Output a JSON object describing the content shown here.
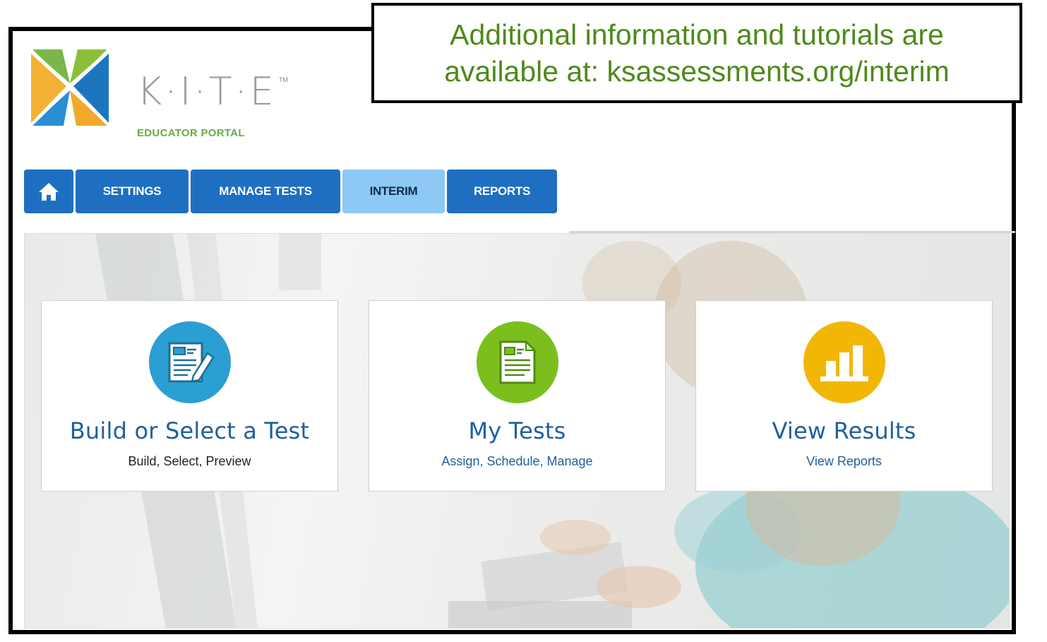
{
  "callout": {
    "line1": "Additional information and tutorials are",
    "line2": "available at: ksassessments.org/interim"
  },
  "brand": {
    "logo_letters": "K·I·T·E",
    "tm": "TM",
    "subtitle": "EDUCATOR PORTAL"
  },
  "nav": {
    "home_icon": "home-icon",
    "tabs": [
      {
        "label": "SETTINGS"
      },
      {
        "label": "MANAGE TESTS"
      },
      {
        "label": "INTERIM",
        "active": true
      },
      {
        "label": "REPORTS"
      }
    ]
  },
  "cards": [
    {
      "icon": "document-edit-icon",
      "title": "Build or Select a Test",
      "subtitle": "Build, Select, Preview",
      "color": "#2b9fd1"
    },
    {
      "icon": "document-icon",
      "title": "My Tests",
      "subtitle": "Assign, Schedule, Manage",
      "color": "#7bbf1f"
    },
    {
      "icon": "bar-chart-icon",
      "title": "View Results",
      "subtitle": "View Reports",
      "color": "#f2b705"
    }
  ],
  "colors": {
    "nav_blue": "#1e6fc2",
    "nav_active": "#8ec8f4",
    "callout_text": "#4e8a1b",
    "card_title": "#1f5f9f"
  }
}
